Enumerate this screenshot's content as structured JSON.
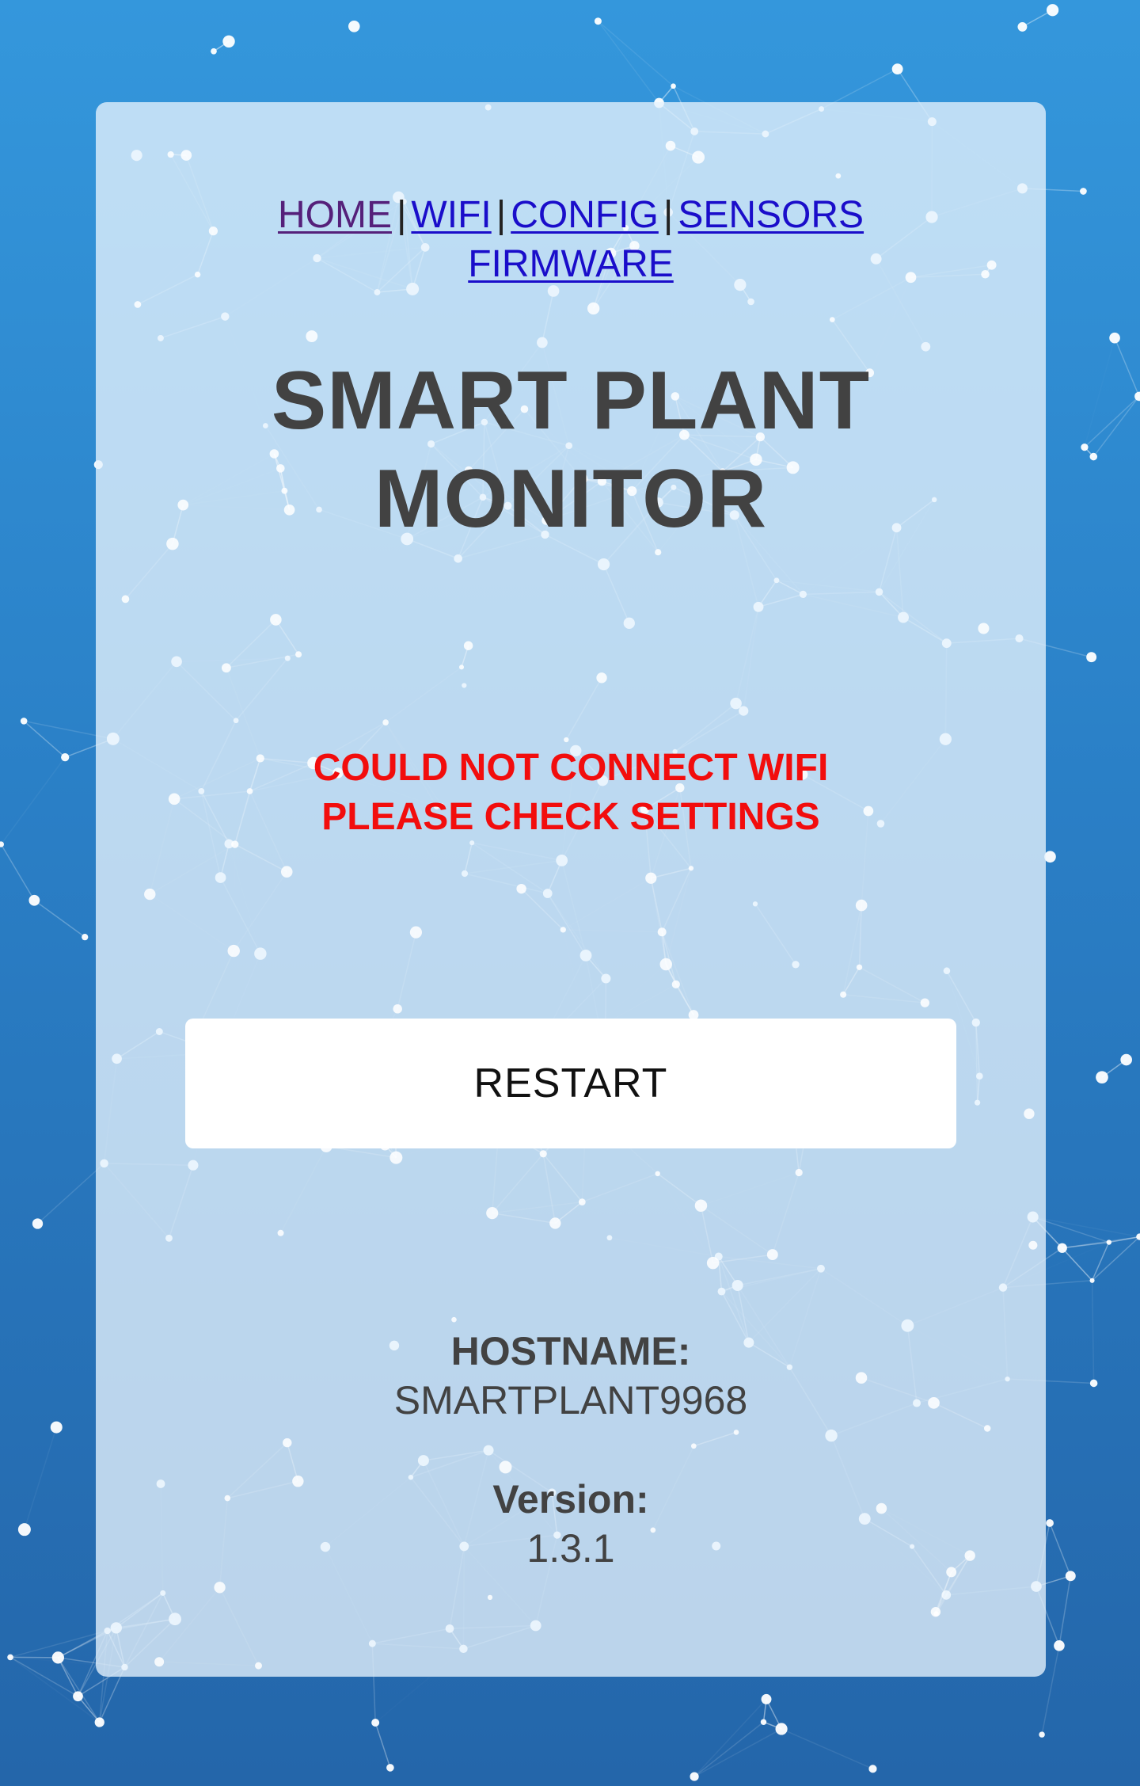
{
  "nav": {
    "links": [
      {
        "label": "HOME",
        "visited": true
      },
      {
        "label": "WIFI",
        "visited": false
      },
      {
        "label": "CONFIG",
        "visited": false
      },
      {
        "label": "SENSORS",
        "visited": false
      },
      {
        "label": "FIRMWARE",
        "visited": false
      }
    ],
    "separator": "|"
  },
  "title": {
    "line1": "SMART PLANT",
    "line2": "MONITOR"
  },
  "error": {
    "line1": "COULD NOT CONNECT WIFI",
    "line2": "PLEASE CHECK SETTINGS"
  },
  "restart_button": {
    "label": "RESTART"
  },
  "hostname": {
    "label": "HOSTNAME:",
    "value": "SMARTPLANT9968"
  },
  "version": {
    "label": "Version:",
    "value": "1.3.1"
  },
  "colors": {
    "background_top": "#3497dc",
    "background_bottom": "#2466aa",
    "link": "#1a0dca",
    "link_visited": "#55207a",
    "error": "#f20d0d",
    "text": "#424242"
  }
}
